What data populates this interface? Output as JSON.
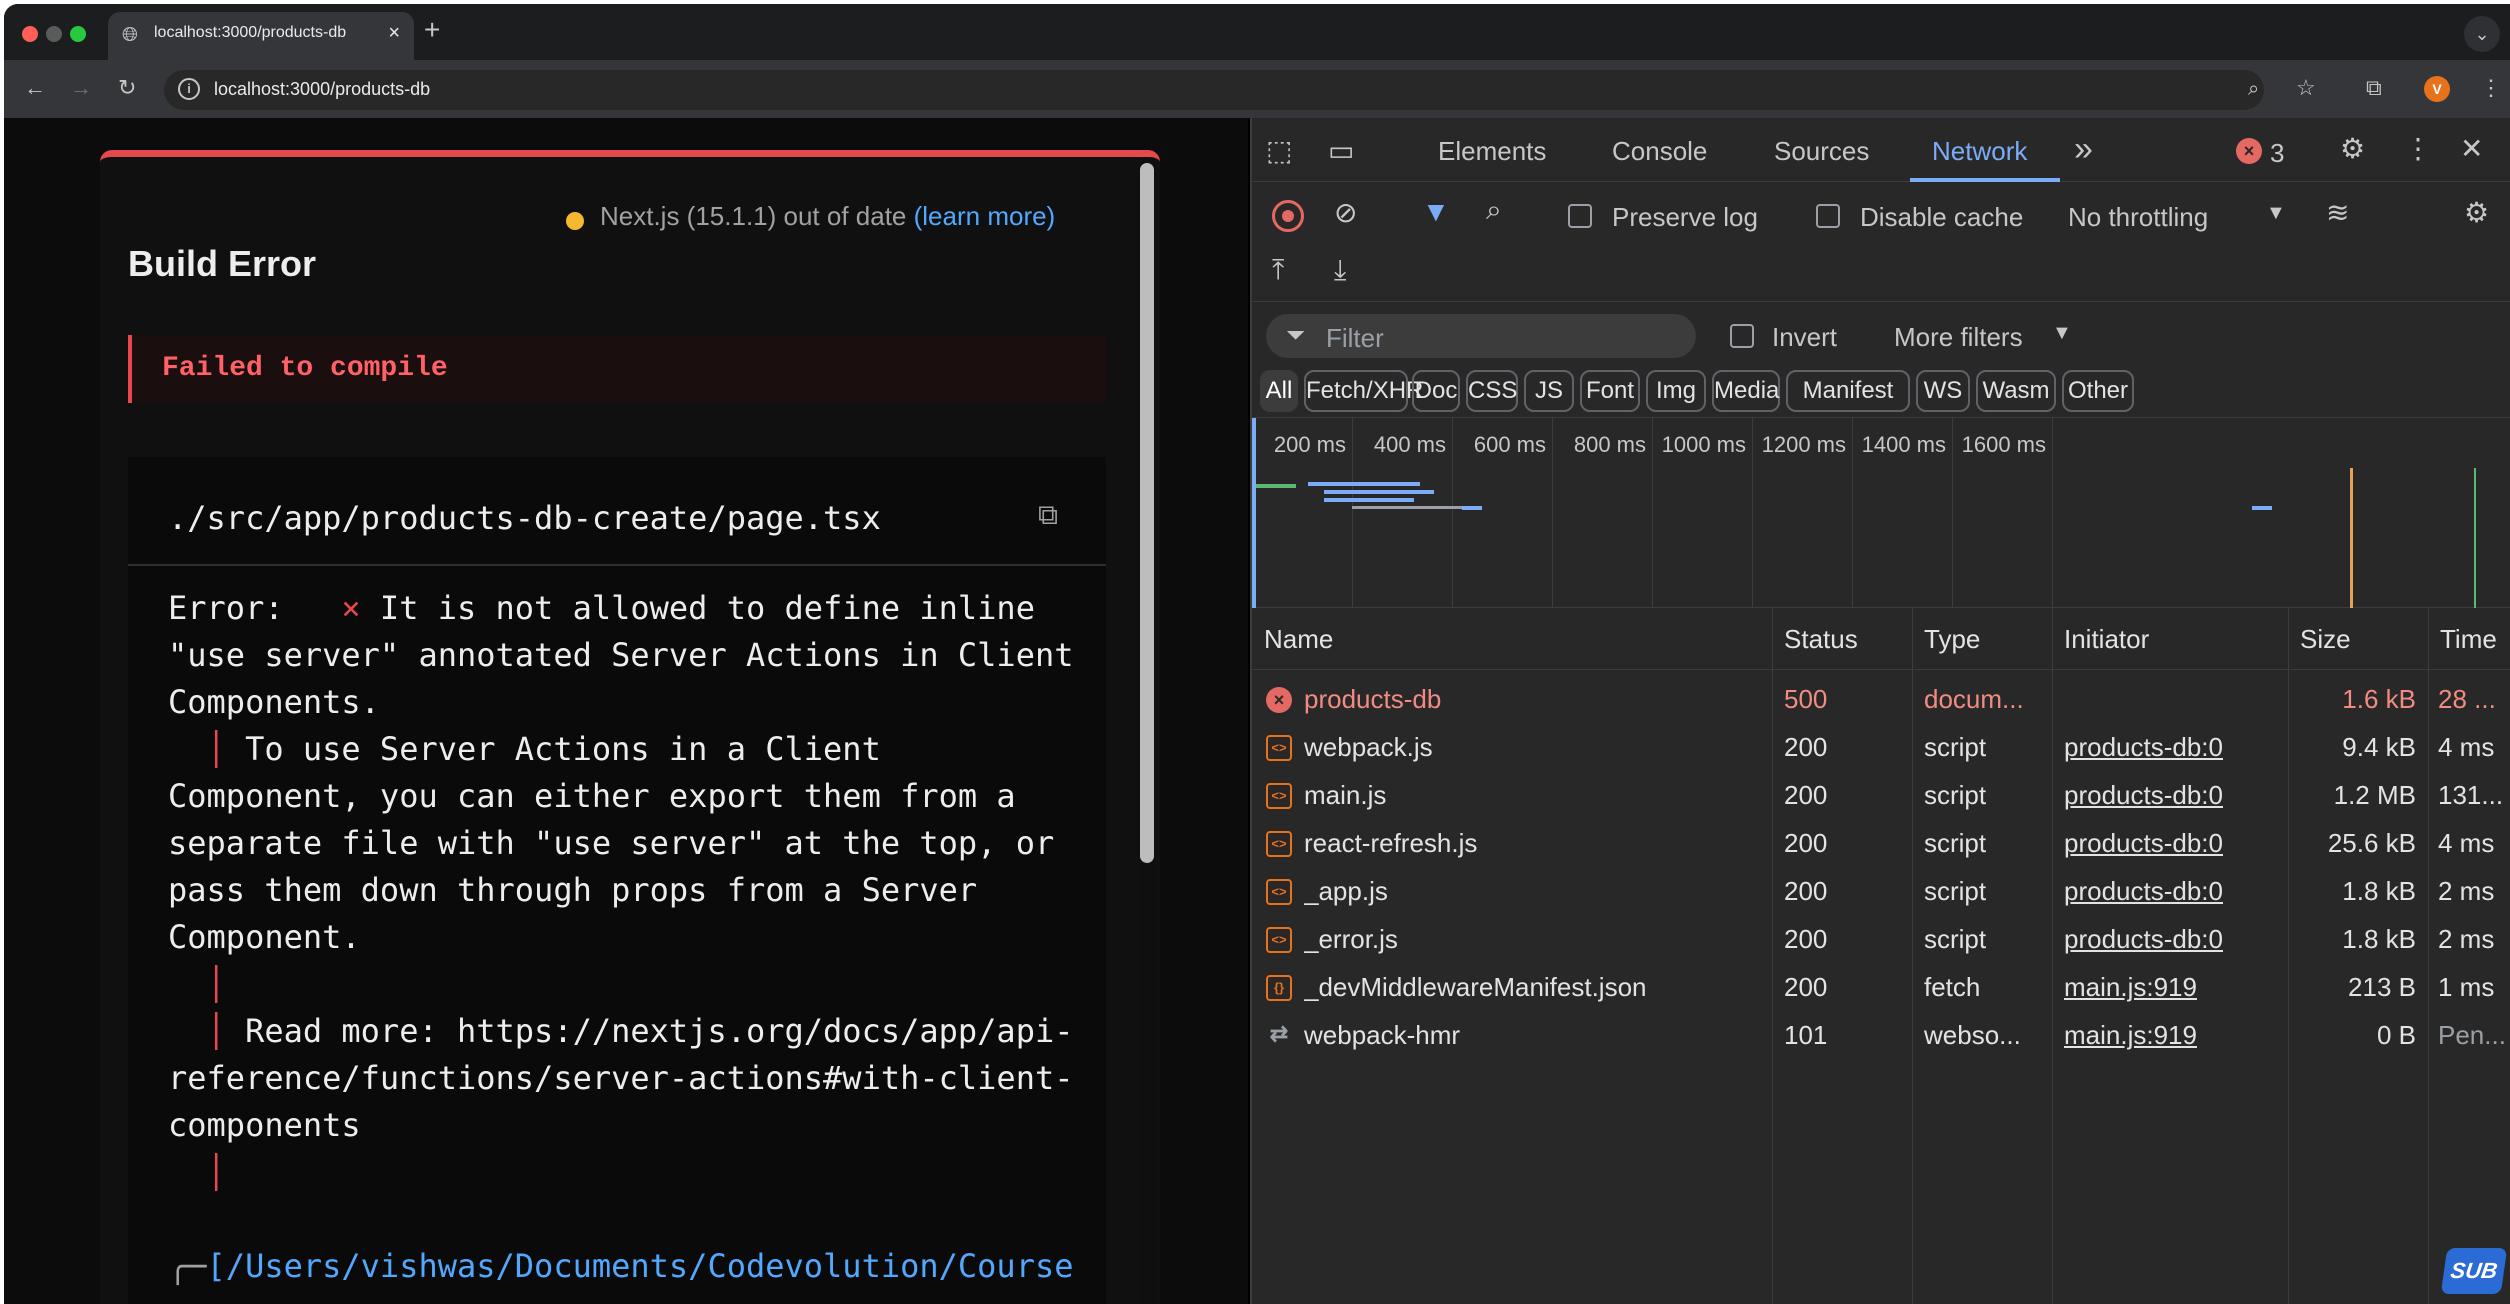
{
  "browser": {
    "tab_title": "localhost:3000/products-db",
    "tab_close": "×",
    "new_tab": "+",
    "url": "localhost:3000/products-db",
    "avatar_letter": "V"
  },
  "overlay": {
    "version_text": "Next.js (15.1.1) out of date ",
    "learn_more": "(learn more)",
    "title": "Build Error",
    "fail_message": "Failed to compile",
    "file_path": "./src/app/products-db-create/page.tsx",
    "code_lines": [
      {
        "prefix": "Error:   ",
        "mark": "×",
        "text": " It is not allowed to define inline"
      },
      {
        "text": "\"use server\" annotated Server Actions in Client"
      },
      {
        "text": "Components."
      },
      {
        "bar": "  │",
        "text": " To use Server Actions in a Client"
      },
      {
        "text": "Component, you can either export them from a"
      },
      {
        "text": "separate file with \"use server\" at the top, or"
      },
      {
        "text": "pass them down through props from a Server"
      },
      {
        "text": "Component."
      },
      {
        "bar": "  │",
        "text": ""
      },
      {
        "bar": "  │",
        "text": " Read more: https://nextjs.org/docs/app/api-"
      },
      {
        "text": "reference/functions/server-actions#with-client-"
      },
      {
        "text": "components"
      },
      {
        "bar": "  │",
        "text": ""
      },
      {
        "text": ""
      },
      {
        "prefix": "╭─",
        "path": "[/Users/vishwas/Documents/Codevolution/Course"
      }
    ]
  },
  "devtools": {
    "tabs": [
      "Elements",
      "Console",
      "Sources",
      "Network"
    ],
    "more_tabs": "»",
    "error_count": "3",
    "preserve_log": "Preserve log",
    "disable_cache": "Disable cache",
    "throttling": "No throttling",
    "filter_placeholder": "Filter",
    "invert": "Invert",
    "more_filters": "More filters",
    "type_filters": [
      "All",
      "Fetch/XHR",
      "Doc",
      "CSS",
      "JS",
      "Font",
      "Img",
      "Media",
      "Manifest",
      "WS",
      "Wasm",
      "Other"
    ],
    "timeline_ticks": [
      "200 ms",
      "400 ms",
      "600 ms",
      "800 ms",
      "1000 ms",
      "1200 ms",
      "1400 ms",
      "1600 ms"
    ],
    "columns": [
      "Name",
      "Status",
      "Type",
      "Initiator",
      "Size",
      "Time"
    ],
    "rows": [
      {
        "icon": "error-icon",
        "name": "products-db",
        "status": "500",
        "type": "docum...",
        "initiator": "",
        "size": "1.6 kB",
        "time": "28 ...",
        "error": true
      },
      {
        "icon": "script-icon",
        "name": "webpack.js",
        "status": "200",
        "type": "script",
        "initiator": "products-db:0",
        "size": "9.4 kB",
        "time": "4 ms"
      },
      {
        "icon": "script-icon",
        "name": "main.js",
        "status": "200",
        "type": "script",
        "initiator": "products-db:0",
        "size": "1.2 MB",
        "time": "131..."
      },
      {
        "icon": "script-icon",
        "name": "react-refresh.js",
        "status": "200",
        "type": "script",
        "initiator": "products-db:0",
        "size": "25.6 kB",
        "time": "4 ms"
      },
      {
        "icon": "script-icon",
        "name": "_app.js",
        "status": "200",
        "type": "script",
        "initiator": "products-db:0",
        "size": "1.8 kB",
        "time": "2 ms"
      },
      {
        "icon": "script-icon",
        "name": "_error.js",
        "status": "200",
        "type": "script",
        "initiator": "products-db:0",
        "size": "1.8 kB",
        "time": "2 ms"
      },
      {
        "icon": "json-icon",
        "name": "_devMiddlewareManifest.json",
        "status": "200",
        "type": "fetch",
        "initiator": "main.js:919",
        "size": "213 B",
        "time": "1 ms"
      },
      {
        "icon": "websocket-icon",
        "name": "webpack-hmr",
        "status": "101",
        "type": "webso...",
        "initiator": "main.js:919",
        "size": "0 B",
        "time": "Pen...",
        "pending": true
      }
    ]
  },
  "watermark": "SUB"
}
